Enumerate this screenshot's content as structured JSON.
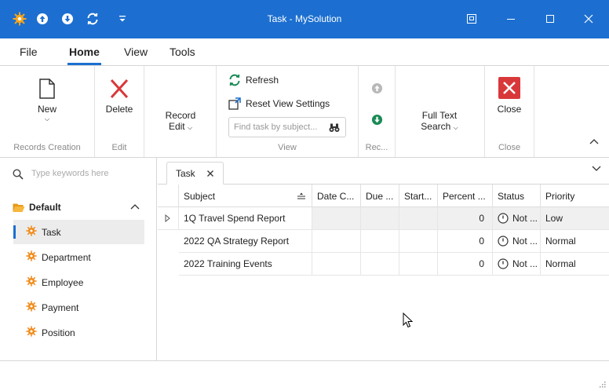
{
  "window": {
    "title": "Task - MySolution"
  },
  "menu": {
    "tabs": [
      "File",
      "Home",
      "View",
      "Tools"
    ],
    "active": "Home"
  },
  "ribbon": {
    "records_creation": {
      "label": "Records Creation",
      "new_label": "New"
    },
    "edit": {
      "label": "Edit",
      "delete_label": "Delete"
    },
    "record_edit": {
      "label_line1": "Record",
      "label_line2": "Edit"
    },
    "view": {
      "label": "View",
      "refresh_label": "Refresh",
      "reset_label": "Reset View Settings",
      "search_placeholder": "Find task by subject..."
    },
    "rec": {
      "label": "Rec..."
    },
    "fulltext": {
      "label_line1": "Full Text",
      "label_line2": "Search"
    },
    "close": {
      "label": "Close",
      "close_label": "Close"
    }
  },
  "sidebar": {
    "search_placeholder": "Type keywords here",
    "group": "Default",
    "items": [
      {
        "label": "Task",
        "selected": true
      },
      {
        "label": "Department"
      },
      {
        "label": "Employee"
      },
      {
        "label": "Payment"
      },
      {
        "label": "Position"
      }
    ]
  },
  "document_tab": {
    "label": "Task"
  },
  "grid": {
    "columns": [
      "Subject",
      "Date C...",
      "Due ...",
      "Start...",
      "Percent ...",
      "Status",
      "Priority"
    ],
    "rows": [
      {
        "subject": "1Q Travel Spend Report",
        "date_completed": "",
        "due": "",
        "start": "",
        "percent": "0",
        "status": "Not ...",
        "priority": "Low"
      },
      {
        "subject": "2022 QA Strategy Report",
        "date_completed": "",
        "due": "",
        "start": "",
        "percent": "0",
        "status": "Not ...",
        "priority": "Normal"
      },
      {
        "subject": "2022 Training Events",
        "date_completed": "",
        "due": "",
        "start": "",
        "percent": "0",
        "status": "Not ...",
        "priority": "Normal"
      }
    ]
  },
  "colors": {
    "accent": "#1c6fd0",
    "delete": "#d9383a",
    "refresh": "#1a8a56",
    "gear": "#f08c1c"
  }
}
